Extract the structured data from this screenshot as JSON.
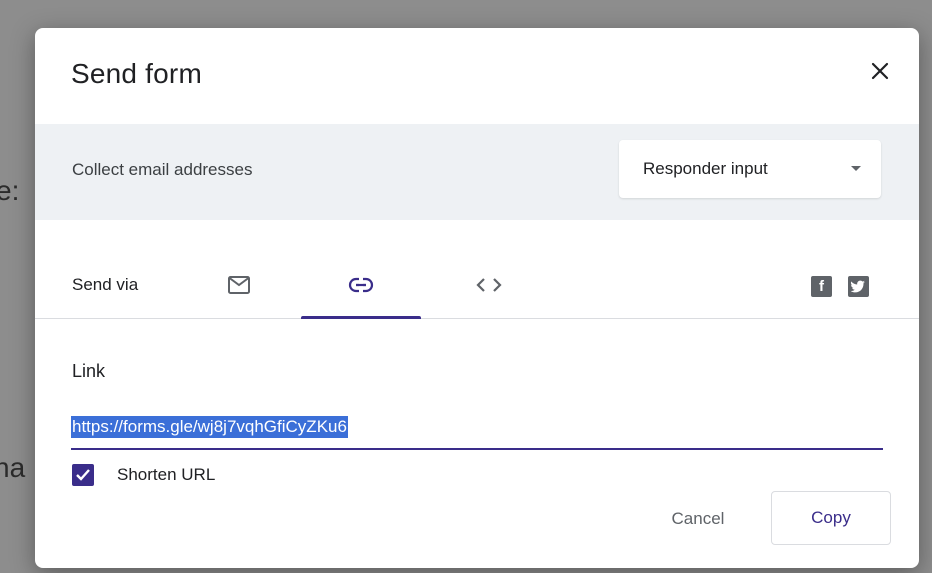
{
  "background": {
    "fragments": [
      "e:",
      "na"
    ]
  },
  "dialog": {
    "title": "Send form",
    "close_icon": "close-icon",
    "collect": {
      "label": "Collect email addresses",
      "selected": "Responder input",
      "caret_icon": "caret-down-icon"
    },
    "send_via": {
      "label": "Send via",
      "tabs": [
        {
          "icon": "email-icon",
          "active": false
        },
        {
          "icon": "link-icon",
          "active": true
        },
        {
          "icon": "embed-icon",
          "active": false
        }
      ],
      "social": [
        {
          "icon": "facebook-icon",
          "glyph": "f"
        },
        {
          "icon": "twitter-icon",
          "glyph": "t"
        }
      ]
    },
    "link": {
      "label": "Link",
      "value": "https://forms.gle/wj8j7vqhGfiCyZKu6"
    },
    "shorten": {
      "label": "Shorten URL",
      "checked": true
    },
    "buttons": {
      "cancel": "Cancel",
      "copy": "Copy"
    }
  },
  "colors": {
    "accent": "#3a2d8a",
    "selection": "#3b6fd8",
    "collect_bg": "#eef1f4"
  }
}
